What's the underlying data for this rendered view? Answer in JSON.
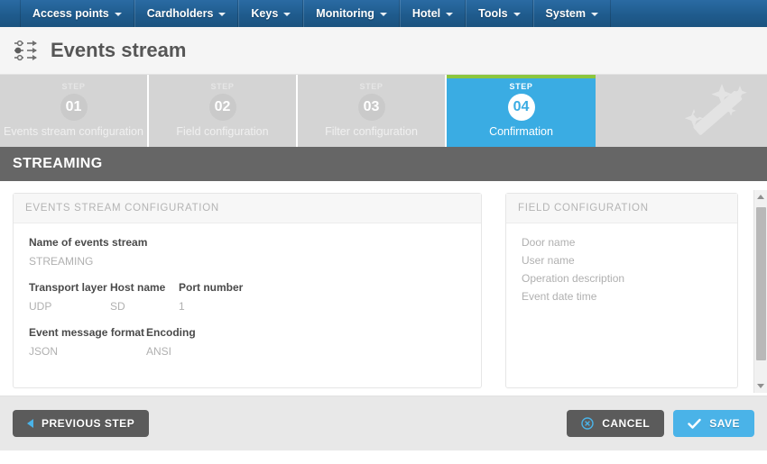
{
  "navbar": {
    "items": [
      {
        "label": "Access points",
        "icon": "chevron-down-icon"
      },
      {
        "label": "Cardholders",
        "icon": "chevron-down-icon"
      },
      {
        "label": "Keys",
        "icon": "chevron-down-icon"
      },
      {
        "label": "Monitoring",
        "icon": "chevron-down-icon"
      },
      {
        "label": "Hotel",
        "icon": "chevron-down-icon"
      },
      {
        "label": "Tools",
        "icon": "chevron-down-icon"
      },
      {
        "label": "System",
        "icon": "chevron-down-icon"
      }
    ]
  },
  "header": {
    "title": "Events stream",
    "icon": "events-stream-icon"
  },
  "wizard": {
    "step_word": "STEP",
    "decoration_icon": "magic-wand-icon",
    "steps": [
      {
        "number": "01",
        "label": "Events stream configuration",
        "active": false
      },
      {
        "number": "02",
        "label": "Field configuration",
        "active": false
      },
      {
        "number": "03",
        "label": "Filter configuration",
        "active": false
      },
      {
        "number": "04",
        "label": "Confirmation",
        "active": true
      }
    ]
  },
  "section": {
    "title": "STREAMING"
  },
  "panels": {
    "left": {
      "header": "EVENTS STREAM CONFIGURATION",
      "blocks": [
        {
          "fields": [
            {
              "label": "Name of events stream",
              "value": "STREAMING"
            }
          ]
        },
        {
          "fields": [
            {
              "label": "Transport layer",
              "value": "UDP"
            },
            {
              "label": "Host name",
              "value": "SD"
            },
            {
              "label": "Port number",
              "value": "1"
            }
          ]
        },
        {
          "fields": [
            {
              "label": "Event message format",
              "value": "JSON"
            },
            {
              "label": "Encoding",
              "value": "ANSI"
            }
          ]
        }
      ]
    },
    "right": {
      "header": "FIELD CONFIGURATION",
      "items": [
        "Door name",
        "User name",
        "Operation description",
        "Event date time"
      ]
    }
  },
  "scrollbar": {
    "up_icon": "scroll-up-arrow-icon",
    "down_icon": "scroll-down-arrow-icon"
  },
  "footer": {
    "previous_label": "PREVIOUS STEP",
    "previous_icon": "chevron-left-icon",
    "cancel_label": "CANCEL",
    "cancel_icon": "cancel-circle-icon",
    "save_label": "SAVE",
    "save_icon": "check-icon"
  },
  "colors": {
    "nav_blue": "#1f5b8d",
    "accent_blue": "#3aace3",
    "accent_green": "#8cc63e",
    "section_gray": "#666666",
    "button_dark": "#5b5b5b",
    "step_inactive": "#d4d4d4"
  }
}
